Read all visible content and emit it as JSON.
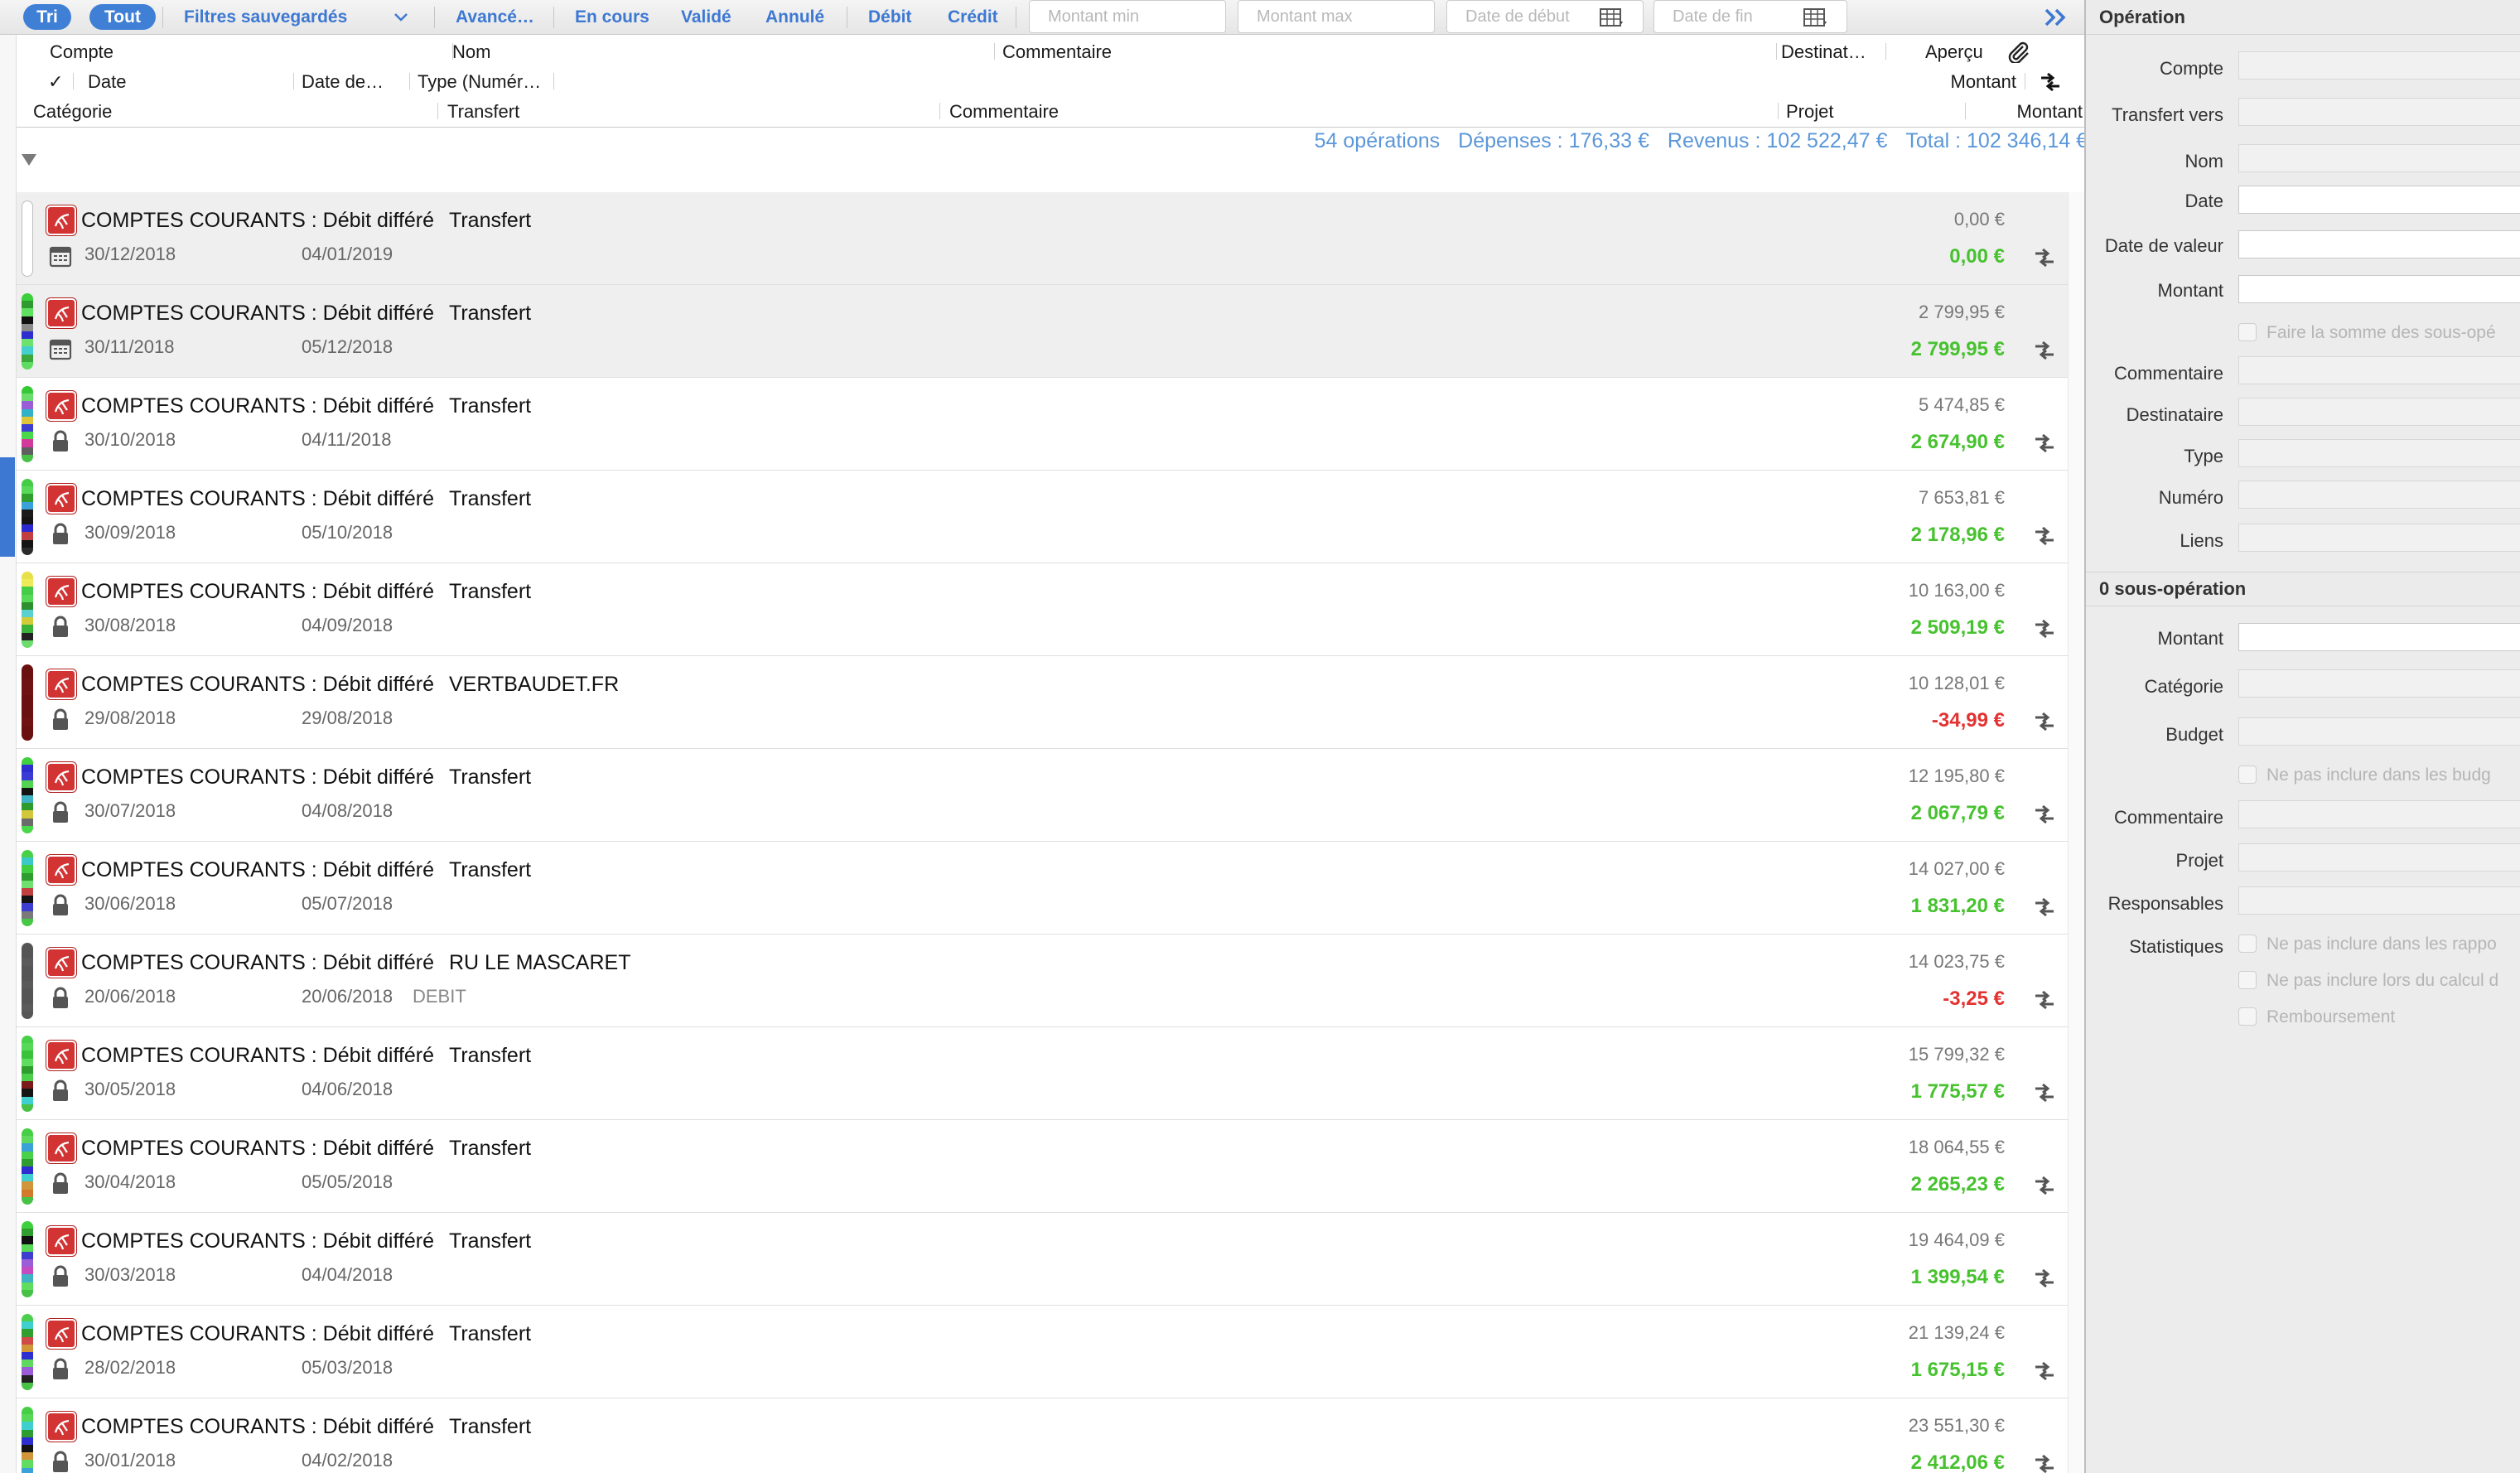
{
  "toolbar": {
    "sort_label": "Tri",
    "all_label": "Tout",
    "saved_filters_label": "Filtres sauvegardés",
    "advanced_label": "Avancé…",
    "status_buttons": [
      "En cours",
      "Validé",
      "Annulé"
    ],
    "type_buttons": [
      "Débit",
      "Crédit"
    ],
    "min_amount_placeholder": "Montant min",
    "max_amount_placeholder": "Montant max",
    "start_date_placeholder": "Date de début",
    "end_date_placeholder": "Date de fin"
  },
  "columns": {
    "line1": [
      "Compte",
      "Nom",
      "Commentaire",
      "Destinat…",
      "Aperçu"
    ],
    "line2": [
      "✓",
      "Date",
      "Date de…",
      "Type (Numér…",
      "Montant"
    ],
    "line3": [
      "Catégorie",
      "Transfert",
      "Commentaire",
      "Projet",
      "Montant"
    ]
  },
  "summary": {
    "count": "54 opérations",
    "expenses": "Dépenses : 176,33 €",
    "income": "Revenus : 102 522,47 €",
    "total": "Total : 102 346,14 €"
  },
  "colors": {
    "accent": "#3f7fd6",
    "positive": "#47c22f",
    "negative": "#e33232",
    "summary_text": "#5b97d8"
  },
  "rows": [
    {
      "account": "COMPTES COURANTS : Débit différé",
      "name": "Transfert",
      "date": "30/12/2018",
      "value_date": "04/01/2019",
      "type": "",
      "balance": "0,00 €",
      "amount": "0,00 €",
      "sign": "pos",
      "status_icon": "calendar-icon",
      "stripe": []
    },
    {
      "account": "COMPTES COURANTS : Débit différé",
      "name": "Transfert",
      "date": "30/11/2018",
      "value_date": "05/12/2018",
      "type": "",
      "balance": "2 799,95 €",
      "amount": "2 799,95 €",
      "sign": "pos",
      "status_icon": "calendar-icon",
      "stripe": [
        "#3ccf3c",
        "#2f9a2f",
        "#60e060",
        "#111111",
        "#8a8a8a",
        "#2d2dd0",
        "#6ee26e",
        "#44cfcf",
        "#3aa83a",
        "#5fdc5f"
      ]
    },
    {
      "account": "COMPTES COURANTS : Débit différé",
      "name": "Transfert",
      "date": "30/10/2018",
      "value_date": "04/11/2018",
      "type": "",
      "balance": "5 474,85 €",
      "amount": "2 674,90 €",
      "sign": "pos",
      "status_icon": "lock-icon",
      "stripe": [
        "#35c835",
        "#6bdd6b",
        "#9b5cd8",
        "#31b2c8",
        "#e0c43a",
        "#3d3dcf",
        "#49d849",
        "#d23a9b",
        "#5f5f5f",
        "#47c247"
      ]
    },
    {
      "account": "COMPTES COURANTS : Débit différé",
      "name": "Transfert",
      "date": "30/09/2018",
      "value_date": "05/10/2018",
      "type": "",
      "balance": "7 653,81 €",
      "amount": "2 178,96 €",
      "sign": "pos",
      "status_icon": "lock-icon",
      "stripe": [
        "#44cc44",
        "#58d858",
        "#2f9e2f",
        "#3aa2d8",
        "#1b1b1b",
        "#151515",
        "#2a2ad0",
        "#c04040",
        "#141414",
        "#2b2b2b"
      ]
    },
    {
      "account": "COMPTES COURANTS : Débit différé",
      "name": "Transfert",
      "date": "30/08/2018",
      "value_date": "04/09/2018",
      "type": "",
      "balance": "10 163,00 €",
      "amount": "2 509,19 €",
      "sign": "pos",
      "status_icon": "lock-icon",
      "stripe": [
        "#e8e048",
        "#eeea5a",
        "#46cc46",
        "#57d857",
        "#2d8f2d",
        "#5ad0d0",
        "#d2cc3a",
        "#3bb33b",
        "#222222",
        "#6ddc6d"
      ]
    },
    {
      "account": "COMPTES COURANTS : Débit différé",
      "name": "VERTBAUDET.FR",
      "date": "29/08/2018",
      "value_date": "29/08/2018",
      "type": "",
      "balance": "10 128,01 €",
      "amount": "-34,99 €",
      "sign": "neg",
      "status_icon": "lock-icon",
      "stripe": [
        "#6b1010",
        "#6b1010",
        "#701212",
        "#701212",
        "#6b1010",
        "#6b1010",
        "#6b1010",
        "#701212",
        "#6b1010",
        "#6b1010"
      ]
    },
    {
      "account": "COMPTES COURANTS : Débit différé",
      "name": "Transfert",
      "date": "30/07/2018",
      "value_date": "04/08/2018",
      "type": "",
      "balance": "12 195,80 €",
      "amount": "2 067,79 €",
      "sign": "pos",
      "status_icon": "lock-icon",
      "stripe": [
        "#3fcf3f",
        "#2d2dd0",
        "#3a3ad6",
        "#52d452",
        "#141414",
        "#3fb2c4",
        "#2e9b2e",
        "#d2c63a",
        "#6b6b6b",
        "#49d849"
      ]
    },
    {
      "account": "COMPTES COURANTS : Débit différé",
      "name": "Transfert",
      "date": "30/06/2018",
      "value_date": "05/07/2018",
      "type": "",
      "balance": "14 027,00 €",
      "amount": "1 831,20 €",
      "sign": "pos",
      "status_icon": "lock-icon",
      "stripe": [
        "#48d048",
        "#3ac8c8",
        "#42cc42",
        "#2e9c2e",
        "#6fe06f",
        "#c04040",
        "#141414",
        "#3d3dcf",
        "#7a7a7a",
        "#46c846"
      ]
    },
    {
      "account": "COMPTES COURANTS : Débit différé",
      "name": "RU LE MASCARET",
      "date": "20/06/2018",
      "value_date": "20/06/2018",
      "type": "DEBIT",
      "balance": "14 023,75 €",
      "amount": "-3,25 €",
      "sign": "neg",
      "status_icon": "lock-icon",
      "stripe": [
        "#555555",
        "#555555",
        "#5a5a5a",
        "#555555",
        "#555555",
        "#5a5a5a",
        "#555555",
        "#555555",
        "#5a5a5a",
        "#555555"
      ]
    },
    {
      "account": "COMPTES COURANTS : Débit différé",
      "name": "Transfert",
      "date": "30/05/2018",
      "value_date": "04/06/2018",
      "type": "",
      "balance": "15 799,32 €",
      "amount": "1 775,57 €",
      "sign": "pos",
      "status_icon": "lock-icon",
      "stripe": [
        "#48d048",
        "#57d857",
        "#3ac23a",
        "#60dc60",
        "#2f9e2f",
        "#4cd04c",
        "#7a1a1a",
        "#141414",
        "#3fcfcf",
        "#47c247"
      ]
    },
    {
      "account": "COMPTES COURANTS : Débit différé",
      "name": "Transfert",
      "date": "30/04/2018",
      "value_date": "05/05/2018",
      "type": "",
      "balance": "18 064,55 €",
      "amount": "2 265,23 €",
      "sign": "pos",
      "status_icon": "lock-icon",
      "stripe": [
        "#46ce46",
        "#5fd85f",
        "#3aa2d8",
        "#4bd04b",
        "#2e9c2e",
        "#2d2dd0",
        "#3fcfcf",
        "#d2963a",
        "#d27a2a",
        "#47c247"
      ]
    },
    {
      "account": "COMPTES COURANTS : Débit différé",
      "name": "Transfert",
      "date": "30/03/2018",
      "value_date": "04/04/2018",
      "type": "",
      "balance": "19 464,09 €",
      "amount": "1 399,54 €",
      "sign": "pos",
      "status_icon": "lock-icon",
      "stripe": [
        "#3fcf3f",
        "#2f9e2f",
        "#111111",
        "#57d857",
        "#3d3dcf",
        "#9b5cd8",
        "#c44ac4",
        "#3fb2c4",
        "#60dc60",
        "#47c247"
      ]
    },
    {
      "account": "COMPTES COURANTS : Débit différé",
      "name": "Transfert",
      "date": "28/02/2018",
      "value_date": "05/03/2018",
      "type": "",
      "balance": "21 139,24 €",
      "amount": "1 675,15 €",
      "sign": "pos",
      "status_icon": "lock-icon",
      "stripe": [
        "#4ccf4c",
        "#3fcfcf",
        "#2f9e2f",
        "#d04a4a",
        "#d2963a",
        "#2d2dd0",
        "#5fd85f",
        "#9b5cd8",
        "#222222",
        "#47c247"
      ]
    },
    {
      "account": "COMPTES COURANTS : Débit différé",
      "name": "Transfert",
      "date": "30/01/2018",
      "value_date": "04/02/2018",
      "type": "",
      "balance": "23 551,30 €",
      "amount": "2 412,06 €",
      "sign": "pos",
      "status_icon": "lock-icon",
      "stripe": [
        "#46ce46",
        "#58d858",
        "#3fcfcf",
        "#2e9c2e",
        "#2d2dd0",
        "#141414",
        "#d2963a",
        "#60dc60",
        "#3aa2d8",
        "#47c247"
      ]
    }
  ],
  "panel": {
    "operation_title": "Opération",
    "operation_fields": [
      {
        "label": "Compte"
      },
      {
        "label": "Transfert vers"
      },
      {
        "label": "Nom"
      },
      {
        "label": "Date"
      },
      {
        "label": "Date de valeur"
      },
      {
        "label": "Montant"
      }
    ],
    "sum_suboperations_label": "Faire la somme des sous-opé",
    "operation_fields2": [
      {
        "label": "Commentaire"
      },
      {
        "label": "Destinataire"
      },
      {
        "label": "Type"
      },
      {
        "label": "Numéro"
      },
      {
        "label": "Liens"
      }
    ],
    "suboperation_title": "0 sous-opération",
    "sub_fields": [
      {
        "label": "Montant"
      },
      {
        "label": "Catégorie"
      },
      {
        "label": "Budget"
      }
    ],
    "exclude_budget_label": "Ne pas inclure dans les budg",
    "sub_fields2": [
      {
        "label": "Commentaire"
      },
      {
        "label": "Projet"
      },
      {
        "label": "Responsables"
      }
    ],
    "statistics_label": "Statistiques",
    "exclude_reports_label": "Ne pas inclure dans les rappo",
    "exclude_calc_label": "Ne pas inclure lors du calcul d",
    "refund_label": "Remboursement"
  }
}
